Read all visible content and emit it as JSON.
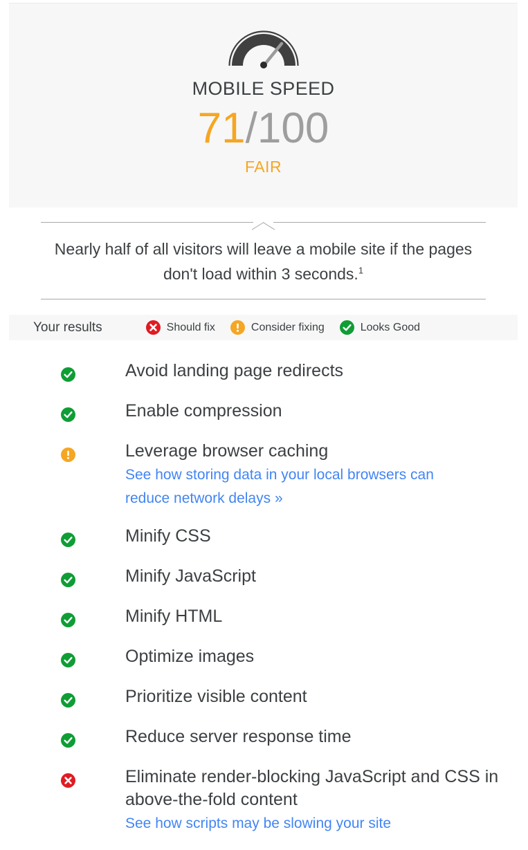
{
  "score_panel": {
    "gauge_icon": "speedometer-gauge-icon",
    "label": "MOBILE SPEED",
    "value": "71",
    "separator": "/",
    "max": "100",
    "verdict": "FAIR",
    "value_color": "#f5a623",
    "max_color": "#9e9e9e",
    "verdict_color": "#f5a623",
    "background": "#f7f7f7"
  },
  "quote": {
    "text": "Nearly half of all visitors will leave a mobile site if the pages don't load within 3 seconds.",
    "footnote": "1"
  },
  "legend": {
    "title": "Your results",
    "items": [
      {
        "icon": "error-circle-icon",
        "label": "Should fix",
        "color": "#e01b22"
      },
      {
        "icon": "warning-circle-icon",
        "label": "Consider fixing",
        "color": "#f5a623"
      },
      {
        "icon": "success-circle-icon",
        "label": "Looks Good",
        "color": "#0f9d35"
      }
    ]
  },
  "results": [
    {
      "status": "good",
      "icon": "success-circle-icon",
      "title": "Avoid landing page redirects",
      "link": ""
    },
    {
      "status": "good",
      "icon": "success-circle-icon",
      "title": "Enable compression",
      "link": ""
    },
    {
      "status": "warning",
      "icon": "warning-circle-icon",
      "title": "Leverage browser caching",
      "link": "See how storing data in your local browsers can reduce network delays »"
    },
    {
      "status": "good",
      "icon": "success-circle-icon",
      "title": "Minify CSS",
      "link": ""
    },
    {
      "status": "good",
      "icon": "success-circle-icon",
      "title": "Minify JavaScript",
      "link": ""
    },
    {
      "status": "good",
      "icon": "success-circle-icon",
      "title": "Minify HTML",
      "link": ""
    },
    {
      "status": "good",
      "icon": "success-circle-icon",
      "title": "Optimize images",
      "link": ""
    },
    {
      "status": "good",
      "icon": "success-circle-icon",
      "title": "Prioritize visible content",
      "link": ""
    },
    {
      "status": "good",
      "icon": "success-circle-icon",
      "title": "Reduce server response time",
      "link": ""
    },
    {
      "status": "error",
      "icon": "error-circle-icon",
      "title": "Eliminate render-blocking JavaScript and CSS in above-the-fold content",
      "link": "See how scripts may be slowing your site"
    }
  ],
  "colors": {
    "error": "#e01b22",
    "warning": "#f5a623",
    "good": "#0f9d35",
    "link": "#4285f4",
    "text": "#3c4043",
    "rule": "#a9a9a9",
    "panel_bg": "#f7f7f7"
  }
}
